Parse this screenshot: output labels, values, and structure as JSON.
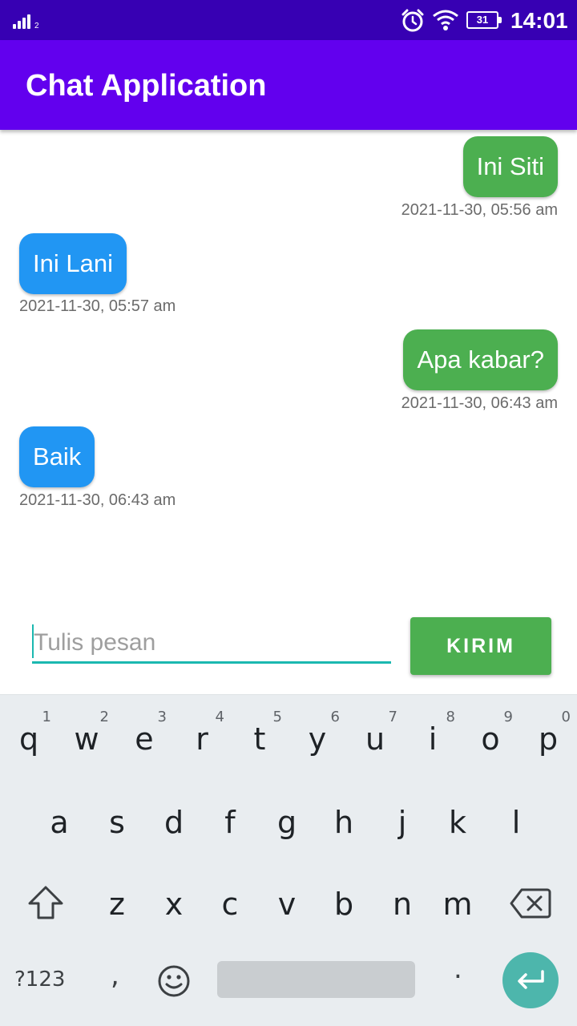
{
  "status_bar": {
    "sim_label": "2",
    "battery": "31",
    "time": "14:01"
  },
  "app_bar": {
    "title": "Chat Application"
  },
  "messages": [
    {
      "text": "Ini Siti",
      "timestamp": "2021-11-30, 05:56 am",
      "direction": "outgoing",
      "color": "#4caf50"
    },
    {
      "text": "Ini Lani",
      "timestamp": "2021-11-30, 05:57 am",
      "direction": "incoming",
      "color": "#2196f3"
    },
    {
      "text": "Apa kabar?",
      "timestamp": "2021-11-30, 06:43 am",
      "direction": "outgoing",
      "color": "#4caf50"
    },
    {
      "text": "Baik",
      "timestamp": "2021-11-30, 06:43 am",
      "direction": "incoming",
      "color": "#2196f3"
    }
  ],
  "composer": {
    "placeholder": "Tulis pesan",
    "value": "",
    "send_label": "KIRIM"
  },
  "keyboard": {
    "row1": [
      {
        "key": "q",
        "hint": "1"
      },
      {
        "key": "w",
        "hint": "2"
      },
      {
        "key": "e",
        "hint": "3"
      },
      {
        "key": "r",
        "hint": "4"
      },
      {
        "key": "t",
        "hint": "5"
      },
      {
        "key": "y",
        "hint": "6"
      },
      {
        "key": "u",
        "hint": "7"
      },
      {
        "key": "i",
        "hint": "8"
      },
      {
        "key": "o",
        "hint": "9"
      },
      {
        "key": "p",
        "hint": "0"
      }
    ],
    "row2": [
      "a",
      "s",
      "d",
      "f",
      "g",
      "h",
      "j",
      "k",
      "l"
    ],
    "row3": [
      "z",
      "x",
      "c",
      "v",
      "b",
      "n",
      "m"
    ],
    "symbols_label": "?123",
    "comma": ",",
    "period": ".",
    "icons": [
      "shift-icon",
      "backspace-icon",
      "emoji-icon",
      "enter-icon"
    ]
  },
  "colors": {
    "status_bar": "#3700b3",
    "app_bar": "#6200ee",
    "outgoing_bubble": "#4caf50",
    "incoming_bubble": "#2196f3",
    "accent": "#1bb8b0",
    "enter_key": "#4db6ac"
  }
}
